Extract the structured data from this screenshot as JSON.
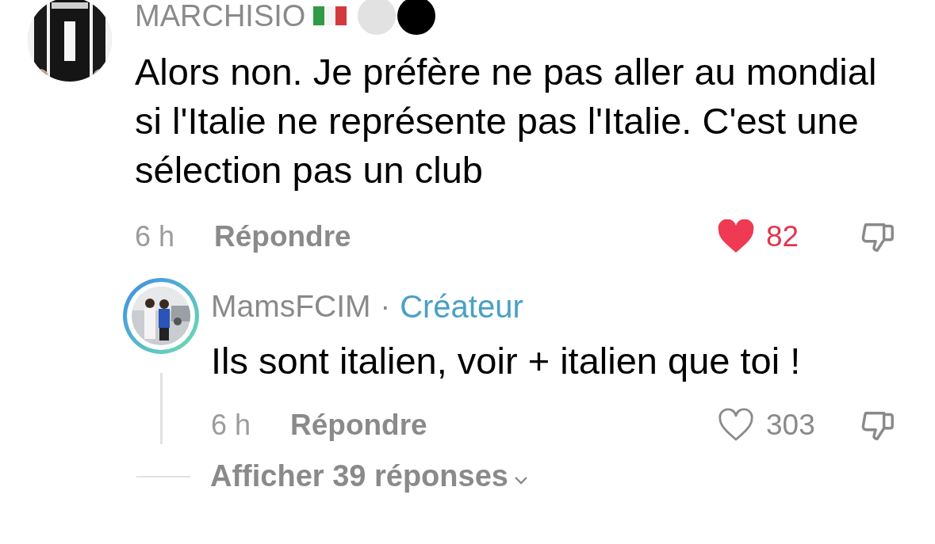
{
  "comment": {
    "author": "MARCHISIO",
    "text": "Alors non. Je préfère ne pas aller au mondial si l'Italie ne représente pas l'Italie. C'est une sélection pas un club",
    "time": "6 h",
    "reply_label": "Répondre",
    "liked": true,
    "likes": "82",
    "reply": {
      "author": "MamsFCIM",
      "separator": "·",
      "badge": "Créateur",
      "story_ring": true,
      "text": "Ils sont italien, voir + italien que toi !",
      "time": "6 h",
      "reply_label": "Répondre",
      "liked": false,
      "likes": "303"
    },
    "more_replies": "Afficher 39 réponses"
  }
}
